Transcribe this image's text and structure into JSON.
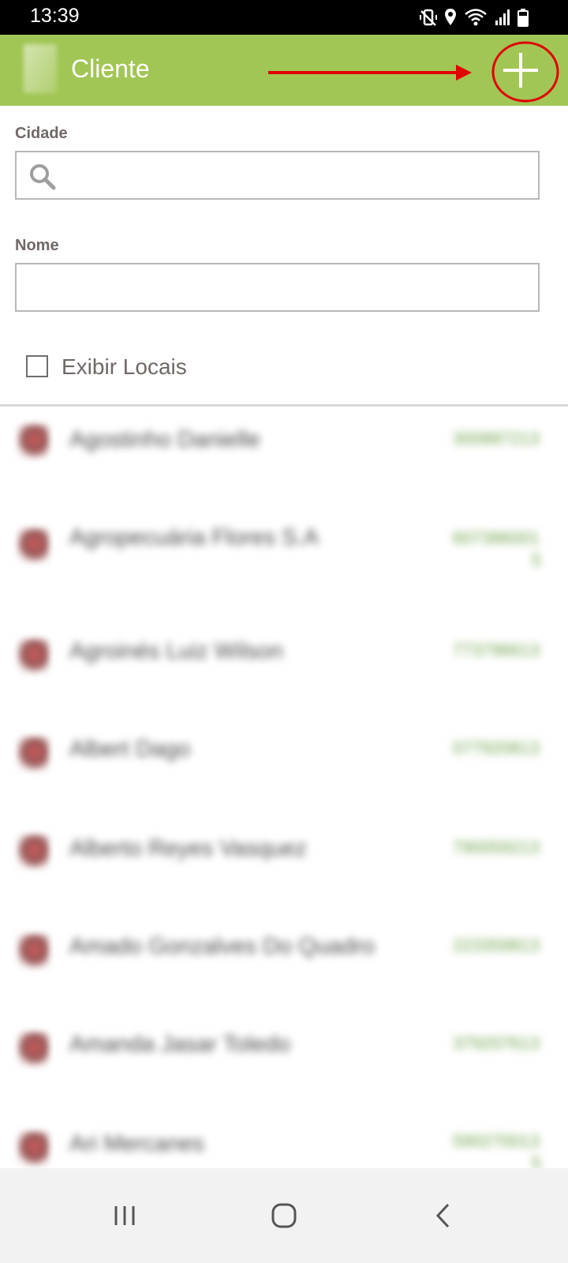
{
  "status_bar": {
    "time": "13:39",
    "icons": [
      "mute-vibrate-icon",
      "location-icon",
      "wifi-icon",
      "signal-icon",
      "battery-icon"
    ]
  },
  "app_bar": {
    "title": "Cliente",
    "background_color": "#a2c655",
    "add_icon": "plus-icon"
  },
  "annotation": {
    "color": "#e00000",
    "shapes": [
      "arrow",
      "circle"
    ]
  },
  "form": {
    "city_label": "Cidade",
    "city_value": "",
    "name_label": "Nome",
    "name_value": "",
    "show_locations_label": "Exibir Locais",
    "show_locations_checked": false
  },
  "client_list": [
    {
      "name": "Agostinho Danielle",
      "code": "300887213"
    },
    {
      "name": "Agropecuária Flores S.A",
      "code": "607386001",
      "code_extra": "5"
    },
    {
      "name": "Agroinés Luiz Wilson",
      "code": "773796613"
    },
    {
      "name": "Albert Dago",
      "code": "077920813"
    },
    {
      "name": "Alberto Reyes Vasquez",
      "code": "790059213"
    },
    {
      "name": "Amado Gonzalves Do Quadro",
      "code": "223359813"
    },
    {
      "name": "Amanda Jasar Toledo",
      "code": "379207613"
    },
    {
      "name": "Ari Mercanes",
      "code": "590270013",
      "code_extra": "5"
    }
  ],
  "nav_bar": {
    "icons": [
      "recent-apps-icon",
      "home-icon",
      "back-icon"
    ]
  }
}
